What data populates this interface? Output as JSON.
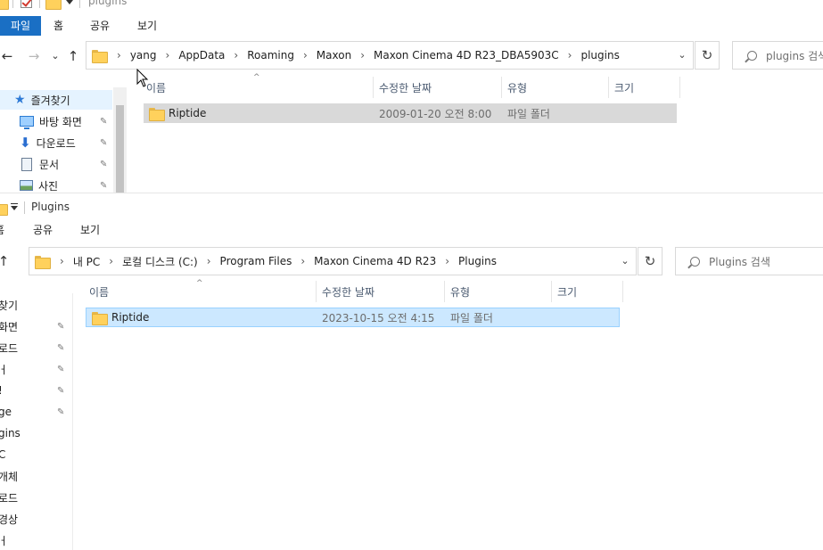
{
  "window1": {
    "title": "plugins",
    "ribbon": {
      "file": "파일",
      "home": "홈",
      "share": "공유",
      "view": "보기"
    },
    "breadcrumbs": [
      "yang",
      "AppData",
      "Roaming",
      "Maxon",
      "Maxon Cinema 4D R23_DBA5903C",
      "plugins"
    ],
    "search_placeholder": "plugins 검색",
    "nav": [
      {
        "label": "즐겨찾기",
        "icon": "star-icon"
      },
      {
        "label": "바탕 화면",
        "icon": "desktop-icon",
        "pinned": true
      },
      {
        "label": "다운로드",
        "icon": "download-icon",
        "pinned": true
      },
      {
        "label": "문서",
        "icon": "document-icon",
        "pinned": true
      },
      {
        "label": "사진",
        "icon": "pictures-icon",
        "pinned": true
      }
    ],
    "columns": {
      "name": "이름",
      "modified": "수정한 날짜",
      "type": "유형",
      "size": "크기"
    },
    "rows": [
      {
        "name": "Riptide",
        "modified": "2009-01-20 오전 8:00",
        "type": "파일 폴더",
        "size": ""
      }
    ]
  },
  "window2": {
    "title": "Plugins",
    "ribbon": {
      "home": "홈",
      "share": "공유",
      "view": "보기"
    },
    "breadcrumbs": [
      "내 PC",
      "로컬 디스크 (C:)",
      "Program Files",
      "Maxon Cinema 4D R23",
      "Plugins"
    ],
    "search_placeholder": "Plugins 검색",
    "nav": [
      {
        "label": "찾기",
        "pinned": false
      },
      {
        "label": "화면",
        "pinned": true
      },
      {
        "label": "로드",
        "pinned": true
      },
      {
        "label": "ㅓ",
        "pinned": true
      },
      {
        "label": "!",
        "pinned": true
      },
      {
        "label": "ge",
        "pinned": true
      },
      {
        "label": "gins",
        "pinned": false
      },
      {
        "label": "C",
        "pinned": false
      },
      {
        "label": "개체",
        "pinned": false
      },
      {
        "label": "로드",
        "pinned": false
      },
      {
        "label": "경상",
        "pinned": false
      },
      {
        "label": "ㅓ",
        "pinned": false
      }
    ],
    "columns": {
      "name": "이름",
      "modified": "수정한 날짜",
      "type": "유형",
      "size": "크기"
    },
    "rows": [
      {
        "name": "Riptide",
        "modified": "2023-10-15 오전 4:15",
        "type": "파일 폴더",
        "size": ""
      }
    ]
  },
  "icons": {
    "back": "←",
    "forward": "→",
    "recent": "⌄",
    "up": "↑",
    "refresh": "↻",
    "pin": "📌",
    "dropdown": "⌄"
  },
  "colors": {
    "file_tab": "#1a6fc4",
    "selection_inactive": "#d9d9d9",
    "selection_active": "#cce8ff",
    "selection_border": "#99d1ff"
  }
}
